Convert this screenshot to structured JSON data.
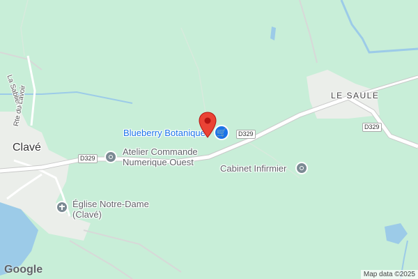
{
  "places": {
    "clave": "Clavé",
    "le_saule": "LE SAULE"
  },
  "roads": {
    "d329_west": "D329",
    "d329_mid": "D329",
    "d329_east": "D329",
    "la_sabliere": "La Sablière",
    "rte_du_lavoir": "Rte du Lavoir"
  },
  "pois": {
    "blueberry": {
      "name": "Blueberry Botanique",
      "icon": "shopping-cart-icon",
      "color": "#1a73e8"
    },
    "atelier": {
      "name_line1": "Atelier Commande",
      "name_line2": "Numerique Ouest",
      "icon": "circle-poi-icon"
    },
    "cabinet": {
      "name": "Cabinet Infirmier",
      "icon": "circle-poi-icon"
    },
    "eglise": {
      "name_line1": "Église Notre-Dame",
      "name_line2": "(Clavé)",
      "icon": "church-icon"
    }
  },
  "marker": {
    "icon": "map-pin-icon",
    "color": "#ea4335"
  },
  "footer": {
    "logo": "Google",
    "attribution": "Map data ©2025"
  },
  "colors": {
    "land": "#c8eed8",
    "water": "#9ccbe8",
    "road": "#ffffff",
    "settlement": "#eeeeee"
  }
}
